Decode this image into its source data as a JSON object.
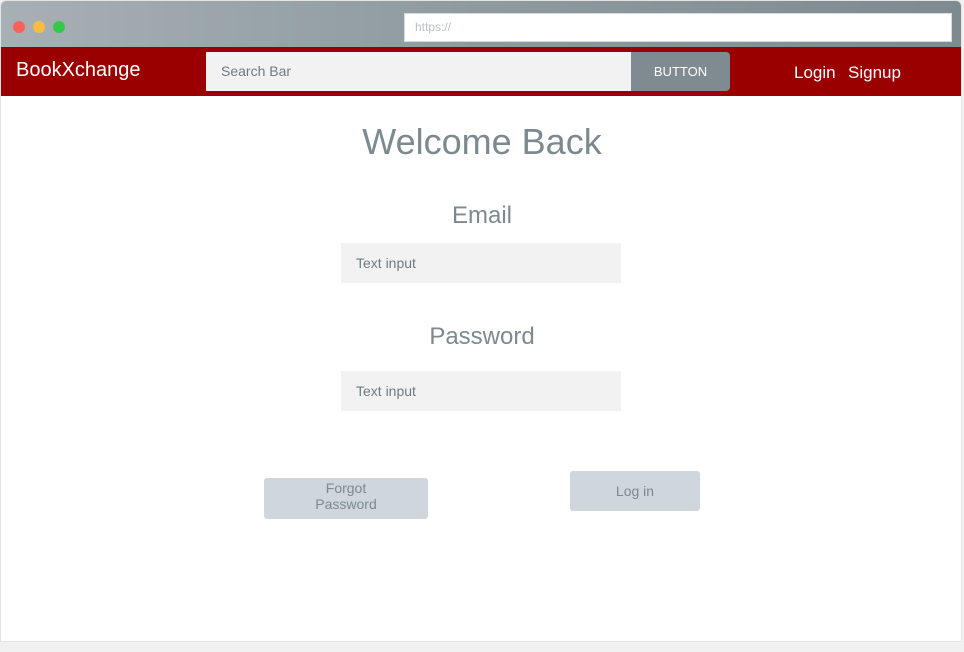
{
  "browser": {
    "url_placeholder": "https://"
  },
  "navbar": {
    "brand": "BookXchange",
    "search_placeholder": "Search Bar",
    "search_button_label": "BUTTON",
    "login_link": "Login",
    "signup_link": "Signup"
  },
  "main": {
    "title": "Welcome Back",
    "email_label": "Email",
    "email_placeholder": "Text input",
    "password_label": "Password",
    "password_placeholder": "Text input",
    "forgot_line1": "Forgot",
    "forgot_line2": "Password",
    "login_button": "Log in"
  },
  "colors": {
    "navbar_bg": "#9b0000",
    "search_button_bg": "#7f8b90",
    "muted_text": "#7c8a8f",
    "button_bg": "#cfd6dc",
    "dot_red": "#fc605c",
    "dot_yellow": "#fdbc40",
    "dot_green": "#34c84a"
  }
}
